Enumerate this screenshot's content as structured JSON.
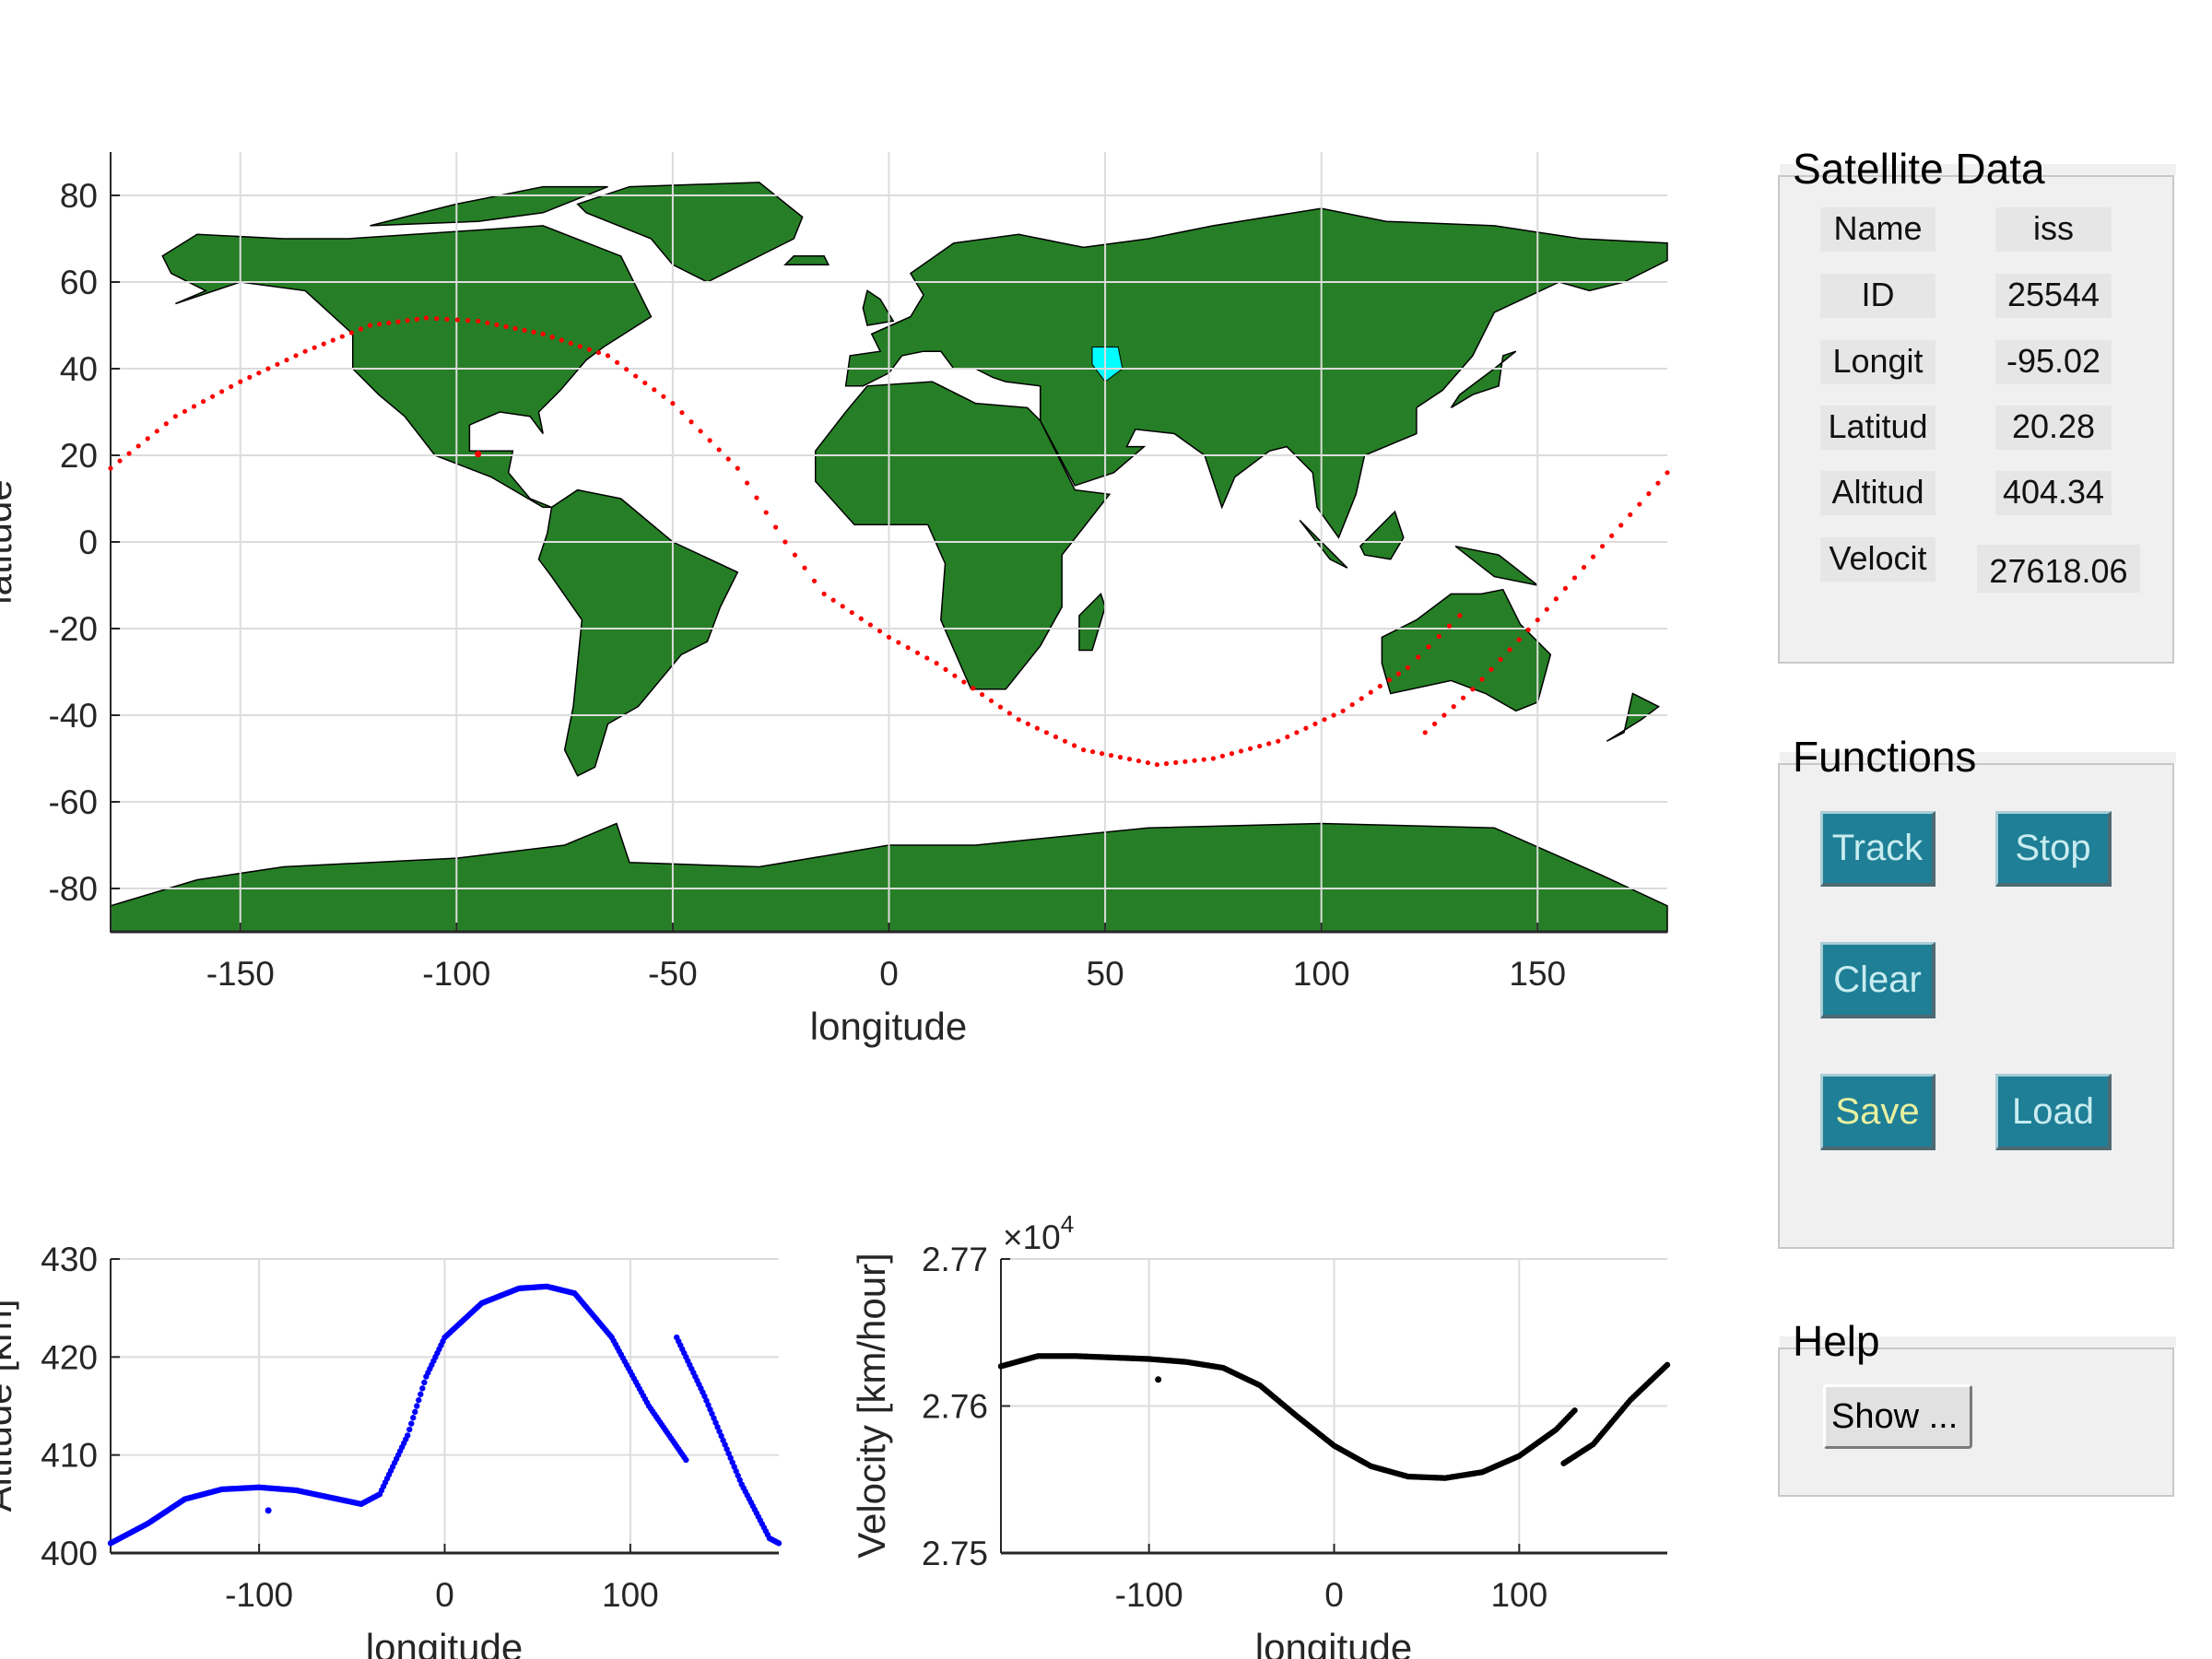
{
  "colors": {
    "land": "#267f26",
    "ocean": "#ffffff",
    "rivers": "#0000ff",
    "lakes": "#00ffff",
    "track": "#ff0000",
    "altitude": "#0000ff",
    "velocity": "#000000",
    "button": "#1e7f96",
    "button_text": "#c8ecf0",
    "save_text": "#e8f0a0",
    "panel": "#f0f0f0"
  },
  "satellite_panel": {
    "title": "Satellite Data",
    "rows": [
      {
        "label": "Name",
        "value": "iss"
      },
      {
        "label": "ID",
        "value": "25544"
      },
      {
        "label": "Longit",
        "value": "-95.02"
      },
      {
        "label": "Latitud",
        "value": "20.28"
      },
      {
        "label": "Altitud",
        "value": "404.34"
      },
      {
        "label": "Velocit",
        "value": "27618.06"
      }
    ]
  },
  "functions_panel": {
    "title": "Functions",
    "track": "Track",
    "stop": "Stop",
    "clear": "Clear",
    "save": "Save",
    "load": "Load"
  },
  "help_panel": {
    "title": "Help",
    "show": "Show ..."
  },
  "chart_data": [
    {
      "type": "scatter",
      "xlabel": "longitude",
      "ylabel": "latitude",
      "xlim": [
        -180,
        180
      ],
      "ylim": [
        -90,
        90
      ],
      "xticks": [
        "-150",
        "-100",
        "-50",
        "0",
        "50",
        "100",
        "150"
      ],
      "yticks": [
        "80",
        "60",
        "40",
        "20",
        "0",
        "-20",
        "-40",
        "-60",
        "-80"
      ],
      "grid": true,
      "background": "world map",
      "series": [
        {
          "lon": [
            -180,
            -165,
            -150,
            -135,
            -120,
            -107,
            -95,
            -80,
            -65,
            -50,
            -35,
            -24,
            -15,
            0,
            11,
            30,
            45,
            62,
            75,
            90,
            105,
            120,
            132
          ],
          "lat": [
            17,
            29,
            37,
            44,
            50,
            51.7,
            51,
            48,
            43,
            32,
            17,
            0,
            -12,
            -22,
            -28,
            -41,
            -48,
            -51.4,
            -50,
            -46,
            -39,
            -29,
            -17
          ]
        },
        {
          "lon": [
            124,
            135,
            150,
            165,
            180
          ],
          "lat": [
            -44,
            -34,
            -18,
            -1,
            16
          ]
        }
      ],
      "current_position": {
        "lon": -95.02,
        "lat": 20.28
      }
    },
    {
      "type": "scatter",
      "xlabel": "longitude",
      "ylabel": "Altitude [km]",
      "xlim": [
        -180,
        180
      ],
      "ylim": [
        400,
        430
      ],
      "xticks": [
        "-100",
        "0",
        "100"
      ],
      "yticks": [
        "430",
        "420",
        "410",
        "400"
      ],
      "grid": true,
      "series": [
        {
          "x": [
            -180,
            -160,
            -140,
            -120,
            -100,
            -80,
            -60,
            -45,
            -35,
            -20,
            -10,
            0,
            20,
            40,
            55,
            70,
            90,
            110,
            130
          ],
          "y": [
            401,
            403,
            405.5,
            406.5,
            406.7,
            406.4,
            405.6,
            405,
            406,
            412,
            418,
            422,
            425.5,
            427,
            427.2,
            426.5,
            422,
            415,
            409.5
          ]
        },
        {
          "x": [
            125,
            140,
            160,
            175,
            180
          ],
          "y": [
            422,
            416,
            407,
            401.5,
            401
          ]
        }
      ],
      "current_position": {
        "x": -95.02,
        "y": 404.34
      }
    },
    {
      "type": "scatter",
      "xlabel": "longitude",
      "ylabel": "Velocity [km/hour]",
      "multiplier": "×10",
      "multiplier_exp": "4",
      "xlim": [
        -180,
        180
      ],
      "ylim": [
        2.75,
        2.77
      ],
      "xticks": [
        "-100",
        "0",
        "100"
      ],
      "yticks": [
        "2.77",
        "2.76",
        "2.75"
      ],
      "grid": true,
      "series": [
        {
          "x": [
            -180,
            -160,
            -140,
            -120,
            -100,
            -80,
            -60,
            -40,
            -20,
            0,
            20,
            40,
            60,
            80,
            100,
            120,
            130
          ],
          "y": [
            2.7627,
            2.7634,
            2.7634,
            2.7633,
            2.7632,
            2.763,
            2.7626,
            2.7614,
            2.7593,
            2.7573,
            2.7559,
            2.7552,
            2.7551,
            2.7555,
            2.7566,
            2.7584,
            2.7597
          ]
        },
        {
          "x": [
            124,
            140,
            160,
            180
          ],
          "y": [
            2.7561,
            2.7574,
            2.7604,
            2.7628
          ]
        }
      ],
      "current_position": {
        "x": -95.02,
        "y": 2.7618
      }
    }
  ]
}
